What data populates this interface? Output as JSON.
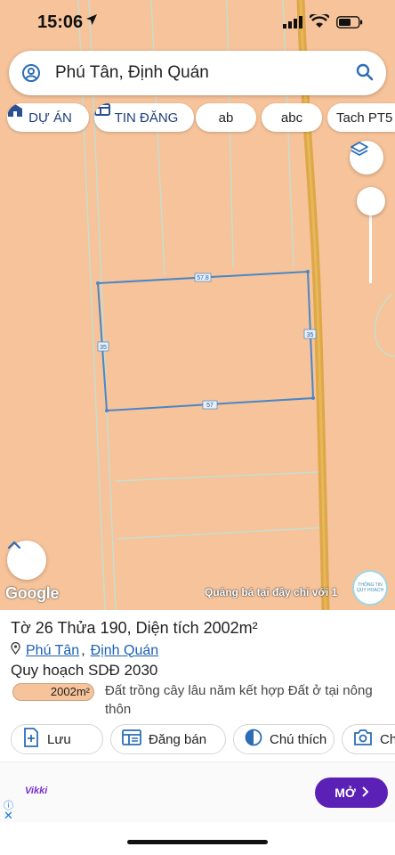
{
  "status": {
    "time": "15:06",
    "location_icon": "location-arrow-icon"
  },
  "search": {
    "query": "Phú Tân, Định Quán",
    "icon": "search-icon",
    "account_icon": "account-icon"
  },
  "chips": [
    {
      "label": "DỰ ÁN",
      "icon": "building-icon"
    },
    {
      "label": "TIN ĐĂNG",
      "icon": "listing-icon"
    },
    {
      "label": "ab"
    },
    {
      "label": "abc"
    },
    {
      "label": "Tach PT5"
    }
  ],
  "map": {
    "parcel_edges": {
      "top": "57.8",
      "left": "35",
      "right": "35",
      "bottom": "57"
    },
    "google_label": "Google",
    "promo_text": "Quảng bá tại đây chỉ với 1",
    "logo_text": "THÔNG TIN QUY HOẠCH",
    "colors": {
      "land": "#f6c39a",
      "parcel_line": "#4a86c5",
      "road": "#d9a23a"
    }
  },
  "panel": {
    "title": "Tờ 26 Thửa 190, Diện tích 2002m²",
    "ward": "Phú Tân",
    "district": "Định Quán",
    "plan": "Quy hoạch SDĐ 2030",
    "area_badge": "2002m²",
    "area_desc": "Đất trồng cây lâu năm kết hợp Đất ở tại nông thôn"
  },
  "actions": [
    {
      "label": "Lưu",
      "icon": "bookmark-add-icon"
    },
    {
      "label": "Đăng bán",
      "icon": "post-sale-icon"
    },
    {
      "label": "Chú thích",
      "icon": "contrast-icon"
    },
    {
      "label": "Chụ",
      "icon": "camera-icon"
    }
  ],
  "ad": {
    "brand": "Vikki",
    "cta": "MỞ"
  }
}
